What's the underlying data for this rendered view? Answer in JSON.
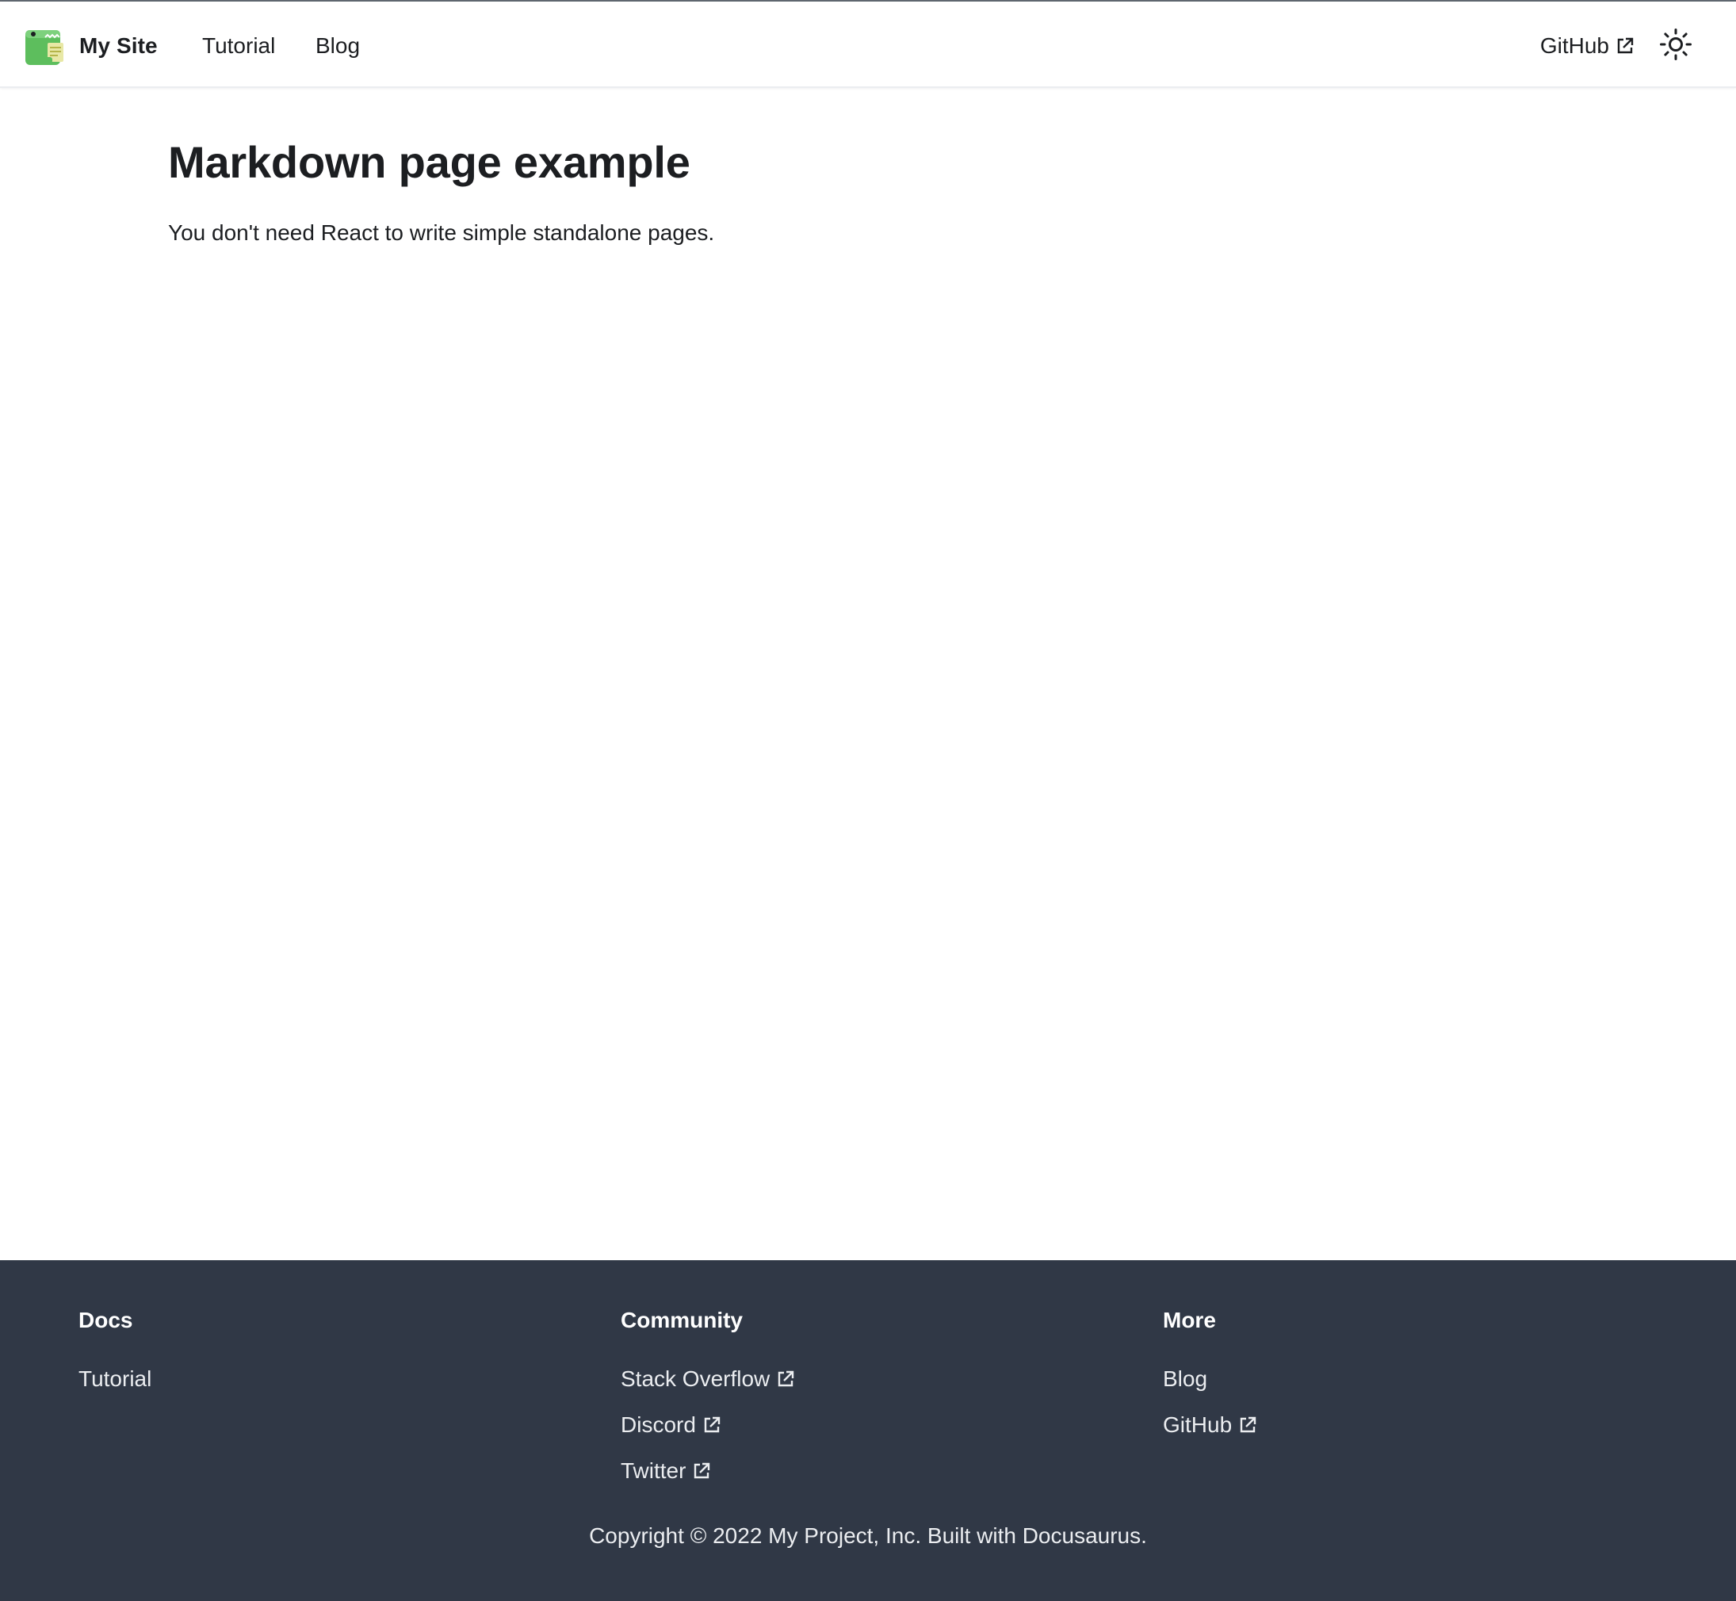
{
  "navbar": {
    "brand_title": "My Site",
    "items": [
      {
        "label": "Tutorial"
      },
      {
        "label": "Blog"
      }
    ],
    "github_label": "GitHub",
    "theme_toggle_icon": "sun-icon"
  },
  "main": {
    "title": "Markdown page example",
    "text": "You don't need React to write simple standalone pages."
  },
  "footer": {
    "columns": [
      {
        "title": "Docs",
        "links": [
          {
            "label": "Tutorial",
            "external": false
          }
        ]
      },
      {
        "title": "Community",
        "links": [
          {
            "label": "Stack Overflow",
            "external": true
          },
          {
            "label": "Discord",
            "external": true
          },
          {
            "label": "Twitter",
            "external": true
          }
        ]
      },
      {
        "title": "More",
        "links": [
          {
            "label": "Blog",
            "external": false
          },
          {
            "label": "GitHub",
            "external": true
          }
        ]
      }
    ],
    "copyright": "Copyright © 2022 My Project, Inc. Built with Docusaurus."
  },
  "colors": {
    "footer_bg": "#303846",
    "text_dark": "#1c1e21",
    "logo_green": "#6cc76c"
  }
}
